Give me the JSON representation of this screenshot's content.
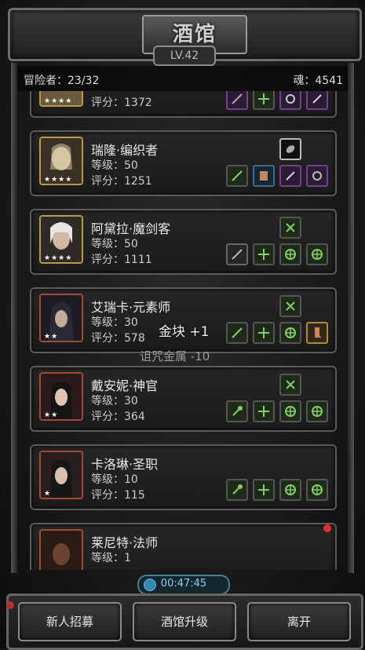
{
  "header": {
    "title": "酒馆",
    "level": "LV.42",
    "adventurers_label": "冒险者：23/32",
    "soul_label": "魂：4541"
  },
  "adventurers": [
    {
      "name": "",
      "level": "",
      "score": "评分：1372",
      "stars": "★★★★",
      "frame": "gold"
    },
    {
      "name": "瑞隆·编织者",
      "level": "等级：50",
      "score": "评分：1251",
      "stars": "★★★★",
      "frame": "gold"
    },
    {
      "name": "阿黛拉·魔剑客",
      "level": "等级：50",
      "score": "评分：1111",
      "stars": "★★★★",
      "frame": "gold"
    },
    {
      "name": "艾瑞卡·元素师",
      "level": "等级：30",
      "score": "评分：578",
      "stars": "★★",
      "frame": "red"
    },
    {
      "name": "戴安妮·神官",
      "level": "等级：30",
      "score": "评分：364",
      "stars": "★★",
      "frame": "red"
    },
    {
      "name": "卡洛琳·圣职",
      "level": "等级：10",
      "score": "评分：115",
      "stars": "★",
      "frame": "red"
    },
    {
      "name": "莱尼特·法师",
      "level": "等级：1",
      "score": "",
      "stars": "",
      "frame": "red"
    }
  ],
  "floating": {
    "gold": "金块 +1",
    "curse": "诅咒金属 -10"
  },
  "timer": "00:47:45",
  "buttons": {
    "recruit": "新人招募",
    "upgrade": "酒馆升级",
    "leave": "离开"
  },
  "colors": {
    "gold_frame": "#b99a48",
    "red_frame": "#a34a37",
    "timer_accent": "#8fd0ea"
  }
}
